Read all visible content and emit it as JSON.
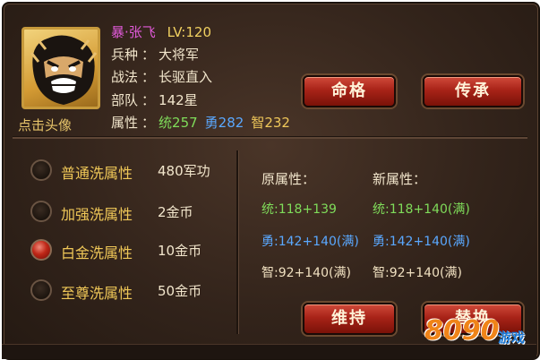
{
  "hero": {
    "name": "暴·张飞",
    "level": "LV:120",
    "avatar_caption": "点击头像",
    "troop_label": "兵种",
    "troop_value": "大将军",
    "tactic_label": "战法",
    "tactic_value": "长驱直入",
    "unit_label": "部队",
    "unit_value": "142星",
    "attr_label": "属性",
    "attr_tong": "统257",
    "attr_yong": "勇282",
    "attr_zhi": "智232",
    "colon": "："
  },
  "buttons": {
    "minge": "命格",
    "chuancheng": "传承",
    "weichi": "维持",
    "tihuan": "替换"
  },
  "wash_options": [
    {
      "label": "普通洗属性",
      "cost": "480军功",
      "selected": false
    },
    {
      "label": "加强洗属性",
      "cost": "2金币",
      "selected": false
    },
    {
      "label": "白金洗属性",
      "cost": "10金币",
      "selected": true
    },
    {
      "label": "至尊洗属性",
      "cost": "50金币",
      "selected": false
    }
  ],
  "attributes": {
    "old_header": "原属性：",
    "new_header": "新属性：",
    "old": [
      "统:118+139",
      "勇:142+140(满)",
      "智:92+140(满)"
    ],
    "new": [
      "统:118+140(满)",
      "勇:142+140(满)",
      "智:92+140(满)"
    ]
  },
  "watermark": {
    "number": "8090",
    "text": "游戏"
  },
  "colors": {
    "name": "#e05ad8",
    "level": "#f0d060",
    "tong": "#7fdc5a",
    "yong": "#5aa8ff",
    "zhi": "#f0c85a",
    "button_red": "#a82318",
    "panel_bg": "#33241b"
  }
}
